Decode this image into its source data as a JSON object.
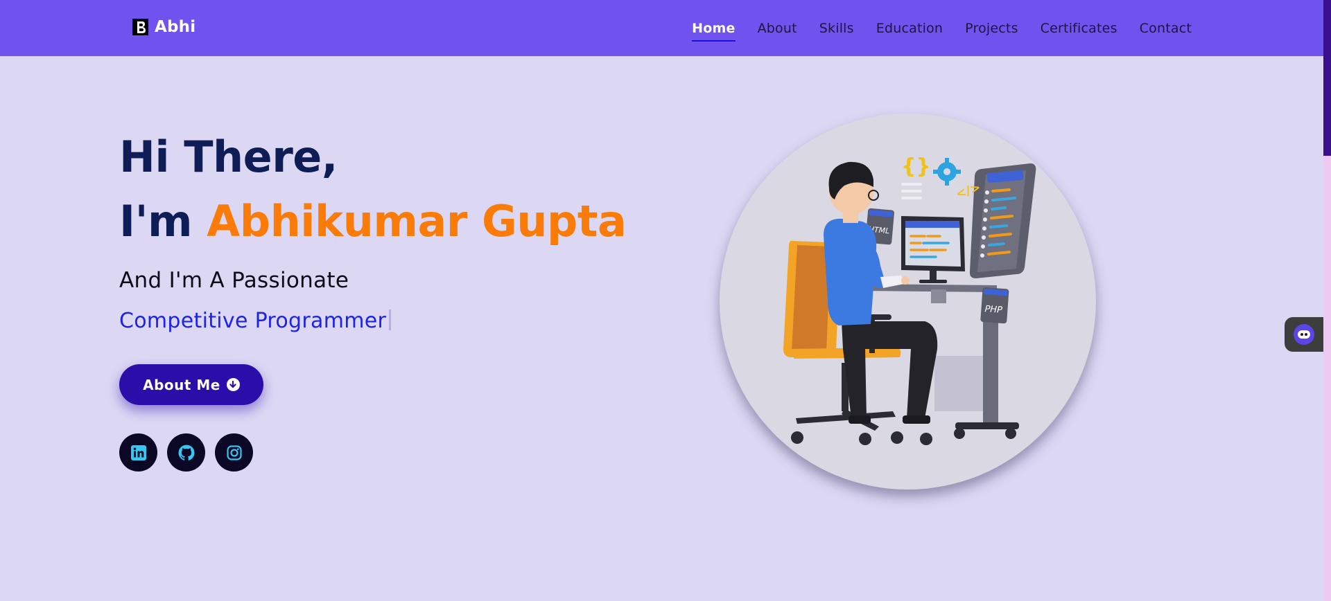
{
  "nav": {
    "brand": "Abhi",
    "links": [
      {
        "label": "Home",
        "active": true
      },
      {
        "label": "About",
        "active": false
      },
      {
        "label": "Skills",
        "active": false
      },
      {
        "label": "Education",
        "active": false
      },
      {
        "label": "Projects",
        "active": false
      },
      {
        "label": "Certificates",
        "active": false
      },
      {
        "label": "Contact",
        "active": false
      }
    ]
  },
  "hero": {
    "greeting": "Hi There,",
    "intro": "I'm ",
    "name": "Abhikumar Gupta",
    "subtitle": "And I'm A Passionate",
    "role": "Competitive Programmer",
    "button_label": "About Me",
    "socials": [
      {
        "icon": "linkedin-icon"
      },
      {
        "icon": "github-icon"
      },
      {
        "icon": "instagram-icon"
      }
    ],
    "illustration_tags": [
      "HTML",
      "PHP",
      "{}",
      "</>"
    ]
  },
  "colors": {
    "nav_bg": "#7053ef",
    "page_bg": "#dcd8f4",
    "heading": "#0e1d55",
    "name_accent": "#fb7b09",
    "role": "#1d23e8",
    "button": "#2a0ea9"
  }
}
